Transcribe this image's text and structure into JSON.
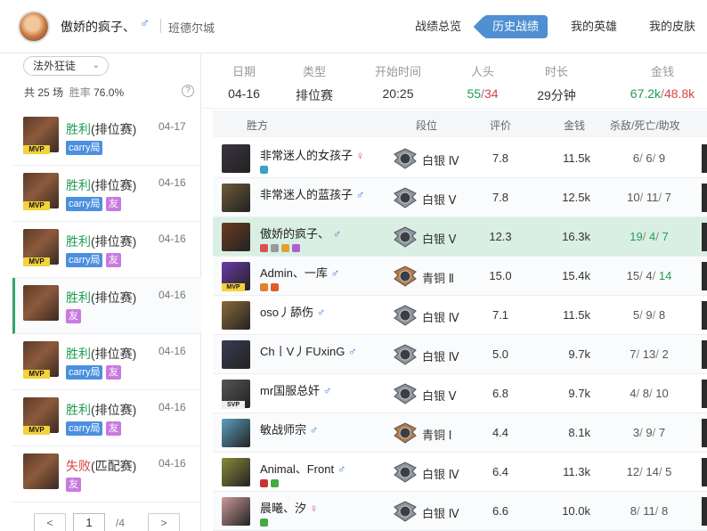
{
  "header": {
    "username": "傲娇的疯子、",
    "gender_symbol": "♂",
    "server": "班德尔城",
    "tabs": [
      "战绩总览",
      "历史战绩",
      "我的英雄",
      "我的皮肤"
    ],
    "active_tab": "历史战绩"
  },
  "sidebar": {
    "mode_select": "法外狂徒",
    "summary_prefix": "共",
    "games": "25",
    "summary_mid": "场",
    "winrate_label": "胜率",
    "winrate": "76.0%",
    "help": "?",
    "matches": [
      {
        "result": "胜利",
        "queue": "(排位赛)",
        "date": "04-17",
        "win": true,
        "mvp": true,
        "carry": "carry局",
        "friend": ""
      },
      {
        "result": "胜利",
        "queue": "(排位赛)",
        "date": "04-16",
        "win": true,
        "mvp": true,
        "carry": "carry局",
        "friend": "友"
      },
      {
        "result": "胜利",
        "queue": "(排位赛)",
        "date": "04-16",
        "win": true,
        "mvp": true,
        "carry": "carry局",
        "friend": "友"
      },
      {
        "result": "胜利",
        "queue": "(排位赛)",
        "date": "04-16",
        "win": true,
        "mvp": false,
        "carry": "",
        "friend": "友"
      },
      {
        "result": "胜利",
        "queue": "(排位赛)",
        "date": "04-16",
        "win": true,
        "mvp": true,
        "carry": "carry局",
        "friend": "友"
      },
      {
        "result": "胜利",
        "queue": "(排位赛)",
        "date": "04-16",
        "win": true,
        "mvp": true,
        "carry": "carry局",
        "friend": "友"
      },
      {
        "result": "失败",
        "queue": "(匹配赛)",
        "date": "04-16",
        "win": false,
        "mvp": false,
        "carry": "",
        "friend": "友"
      }
    ],
    "mvp_label": "MVP",
    "pager": {
      "prev": "<",
      "page": "1",
      "total": "/4",
      "next": ">"
    }
  },
  "summary": {
    "date_label": "日期",
    "date": "04-16",
    "type_label": "类型",
    "type": "排位赛",
    "start_label": "开始时间",
    "start": "20:25",
    "kills_label": "人头",
    "kills_a": "55",
    "kills_sep": "/",
    "kills_b": "34",
    "duration_label": "时长",
    "duration": "29分钟",
    "gold_label": "金钱",
    "gold_a": "67.2k",
    "gold_sep": "/",
    "gold_b": "48.8k"
  },
  "table": {
    "headers": {
      "team": "胜方",
      "rank": "段位",
      "score": "评价",
      "gold": "金钱",
      "kda": "杀敌/死亡/助攻"
    },
    "rows": [
      {
        "name": "非常迷人的女孩子",
        "sex": "♀",
        "rank": "白银 Ⅳ",
        "score": "7.8",
        "gold": "11.5k",
        "k": "6",
        "d": "6",
        "a": "9",
        "badge": "",
        "me": false
      },
      {
        "name": "非常迷人的蓝孩子",
        "sex": "♂",
        "rank": "白银 Ⅴ",
        "score": "7.8",
        "gold": "12.5k",
        "k": "10",
        "d": "11",
        "a": "7",
        "badge": "",
        "me": false
      },
      {
        "name": "傲娇的疯子、",
        "sex": "♂",
        "rank": "白银 Ⅴ",
        "score": "12.3",
        "gold": "16.3k",
        "k": "19",
        "d": "4",
        "a": "7",
        "badge": "",
        "me": true
      },
      {
        "name": "Admin、一库",
        "sex": "♂",
        "rank": "青铜 Ⅱ",
        "score": "15.0",
        "gold": "15.4k",
        "k": "15",
        "d": "4",
        "a": "14",
        "badge": "MVP",
        "me": false
      },
      {
        "name": "oso丿舔伤",
        "sex": "♂",
        "rank": "白银 Ⅳ",
        "score": "7.1",
        "gold": "11.5k",
        "k": "5",
        "d": "9",
        "a": "8",
        "badge": "",
        "me": false
      },
      {
        "name": "Ch丨V丿FUxinG",
        "sex": "♂",
        "rank": "白银 Ⅳ",
        "score": "5.0",
        "gold": "9.7k",
        "k": "7",
        "d": "13",
        "a": "2",
        "badge": "",
        "me": false
      },
      {
        "name": "mr国服总奸",
        "sex": "♂",
        "rank": "白银 Ⅴ",
        "score": "6.8",
        "gold": "9.7k",
        "k": "4",
        "d": "8",
        "a": "10",
        "badge": "SVP",
        "me": false
      },
      {
        "name": "敏战师宗",
        "sex": "♂",
        "rank": "青铜 Ⅰ",
        "score": "4.4",
        "gold": "8.1k",
        "k": "3",
        "d": "9",
        "a": "7",
        "badge": "",
        "me": false
      },
      {
        "name": "Animal、Front",
        "sex": "♂",
        "rank": "白银 Ⅳ",
        "score": "6.4",
        "gold": "11.3k",
        "k": "12",
        "d": "14",
        "a": "5",
        "badge": "",
        "me": false
      },
      {
        "name": "晨曦、汐",
        "sex": "♀",
        "rank": "白银 Ⅳ",
        "score": "6.6",
        "gold": "10.0k",
        "k": "8",
        "d": "11",
        "a": "8",
        "badge": "",
        "me": false
      }
    ]
  },
  "colors": {
    "win": "#1f9d55",
    "lose": "#d64545",
    "accent": "#4f8fd2",
    "male": "#3a7bd5",
    "female": "#e0508a"
  }
}
